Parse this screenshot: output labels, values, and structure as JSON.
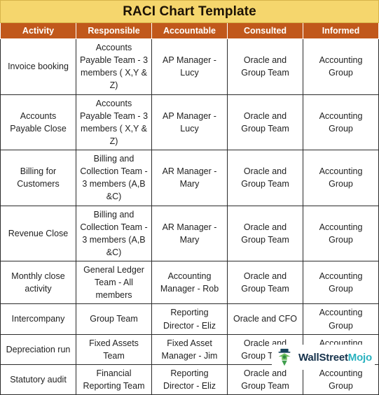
{
  "document": {
    "title": "RACI Chart Template",
    "title_bg_color": "#F5D66D",
    "header_bg_color": "#C1581B",
    "header_text_color": "#FFFFFF",
    "grid_line_color": "#2B2B2B"
  },
  "table": {
    "columns": [
      {
        "key": "activity",
        "label": "Activity"
      },
      {
        "key": "responsible",
        "label": "Responsible"
      },
      {
        "key": "accountable",
        "label": "Accountable"
      },
      {
        "key": "consulted",
        "label": "Consulted"
      },
      {
        "key": "informed",
        "label": "Informed"
      }
    ],
    "rows": [
      {
        "activity": "Invoice booking",
        "responsible": "Accounts Payable Team - 3 members ( X,Y & Z)",
        "accountable": "AP Manager - Lucy",
        "consulted": "Oracle and Group Team",
        "informed": "Accounting Group"
      },
      {
        "activity": "Accounts Payable Close",
        "responsible": "Accounts Payable Team - 3 members ( X,Y & Z)",
        "accountable": "AP Manager - Lucy",
        "consulted": "Oracle and Group Team",
        "informed": "Accounting Group"
      },
      {
        "activity": "Billing for Customers",
        "responsible": "Billing and Collection Team - 3 members (A,B &C)",
        "accountable": "AR Manager - Mary",
        "consulted": "Oracle and Group Team",
        "informed": "Accounting Group"
      },
      {
        "activity": "Revenue Close",
        "responsible": "Billing and Collection Team - 3 members (A,B &C)",
        "accountable": "AR Manager - Mary",
        "consulted": "Oracle and Group Team",
        "informed": "Accounting Group"
      },
      {
        "activity": "Monthly close activity",
        "responsible": "General Ledger Team - All members",
        "accountable": "Accounting Manager - Rob",
        "consulted": "Oracle and Group Team",
        "informed": "Accounting Group"
      },
      {
        "activity": "Intercompany",
        "responsible": "Group Team",
        "accountable": "Reporting Director - Eliz",
        "consulted": "Oracle and CFO",
        "informed": "Accounting Group"
      },
      {
        "activity": "Depreciation run",
        "responsible": "Fixed Assets Team",
        "accountable": "Fixed Asset Manager - Jim",
        "consulted": "Oracle and Group Team",
        "informed": "Accounting Group"
      },
      {
        "activity": "Statutory audit",
        "responsible": "Financial Reporting Team",
        "accountable": "Reporting Director - Eliz",
        "consulted": "Oracle and Group Team",
        "informed": "Accounting Group"
      }
    ]
  },
  "watermark": {
    "icon": "wallstreetmojo-logo-icon",
    "text_primary": "WallStreet",
    "text_secondary": "Mojo",
    "color_primary": "#15314B",
    "color_secondary": "#2BB3C0"
  }
}
